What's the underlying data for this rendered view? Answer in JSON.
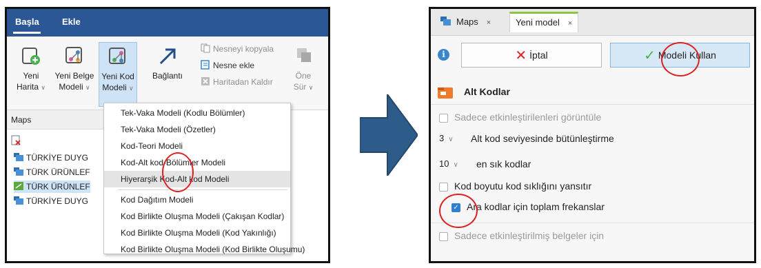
{
  "left": {
    "ribbon_tabs": [
      "Başla",
      "Ekle"
    ],
    "ribbon_buttons": [
      {
        "line1": "Yeni",
        "line2": "Harita",
        "icon": "new-map-icon"
      },
      {
        "line1": "Yeni Belge",
        "line2": "Modeli",
        "icon": "new-document-model-icon"
      },
      {
        "line1": "Yeni Kod",
        "line2": "Modeli",
        "icon": "new-code-model-icon"
      },
      {
        "line1": "Bağlantı",
        "line2": "",
        "icon": "link-arrow-icon"
      }
    ],
    "small_buttons": [
      "Nesneyi kopyala",
      "Nesne ekle",
      "Haritadan Kaldır"
    ],
    "cut_button": {
      "line1": "Öne",
      "line2": "Sür"
    },
    "maps_pane_title": "Maps",
    "tree_items": [
      "TÜRKİYE DUYG",
      "TÜRK ÜRÜNLEF",
      "TÜRK ÜRÜNLEF",
      "TÜRKİYE DUYG"
    ],
    "dropdown": {
      "group1": [
        "Tek-Vaka Modeli (Kodlu Bölümler)",
        "Tek-Vaka Modeli (Özetler)",
        "Kod-Teori Modeli",
        "Kod-Alt kod-Bölümler Modeli",
        "Hiyerarşik Kod-Alt kod Modeli"
      ],
      "group2": [
        "Kod Dağıtım Modeli",
        "Kod Birlikte Oluşma Modeli (Çakışan Kodlar)",
        "Kod Birlikte Oluşma Modeli (Kod Yakınlığı)",
        "Kod Birlikte Oluşma Modeli (Kod Birlikte Oluşumu)"
      ],
      "highlighted": "Hiyerarşik Kod-Alt kod Modeli"
    }
  },
  "right": {
    "tabs": [
      {
        "label": "Maps",
        "close": "×"
      },
      {
        "label": "Yeni model",
        "close": "×"
      }
    ],
    "cancel_label": "İptal",
    "apply_label": "Modeli Kullan",
    "section_title": "Alt Kodlar",
    "options": {
      "only_activated": "Sadece etkinleştirilenleri görüntüle",
      "level_value": "3",
      "level_label": "Alt kod seviyesinde bütünleştirme",
      "top_value": "10",
      "top_label": "en sık kodlar",
      "code_size": "Kod boyutu kod sıklığını yansıtır",
      "total_freq": "Ara kodlar için toplam frekanslar",
      "only_activated_docs": "Sadece etkinleştirilmiş belgeler için"
    },
    "checked": {
      "only_activated": false,
      "code_size": false,
      "total_freq": true,
      "only_activated_docs": false
    }
  },
  "colors": {
    "ribbon_blue": "#2b5797",
    "highlight_red": "#e02020",
    "arrow_blue": "#2e5c8a",
    "accent_green": "#8cc540"
  }
}
